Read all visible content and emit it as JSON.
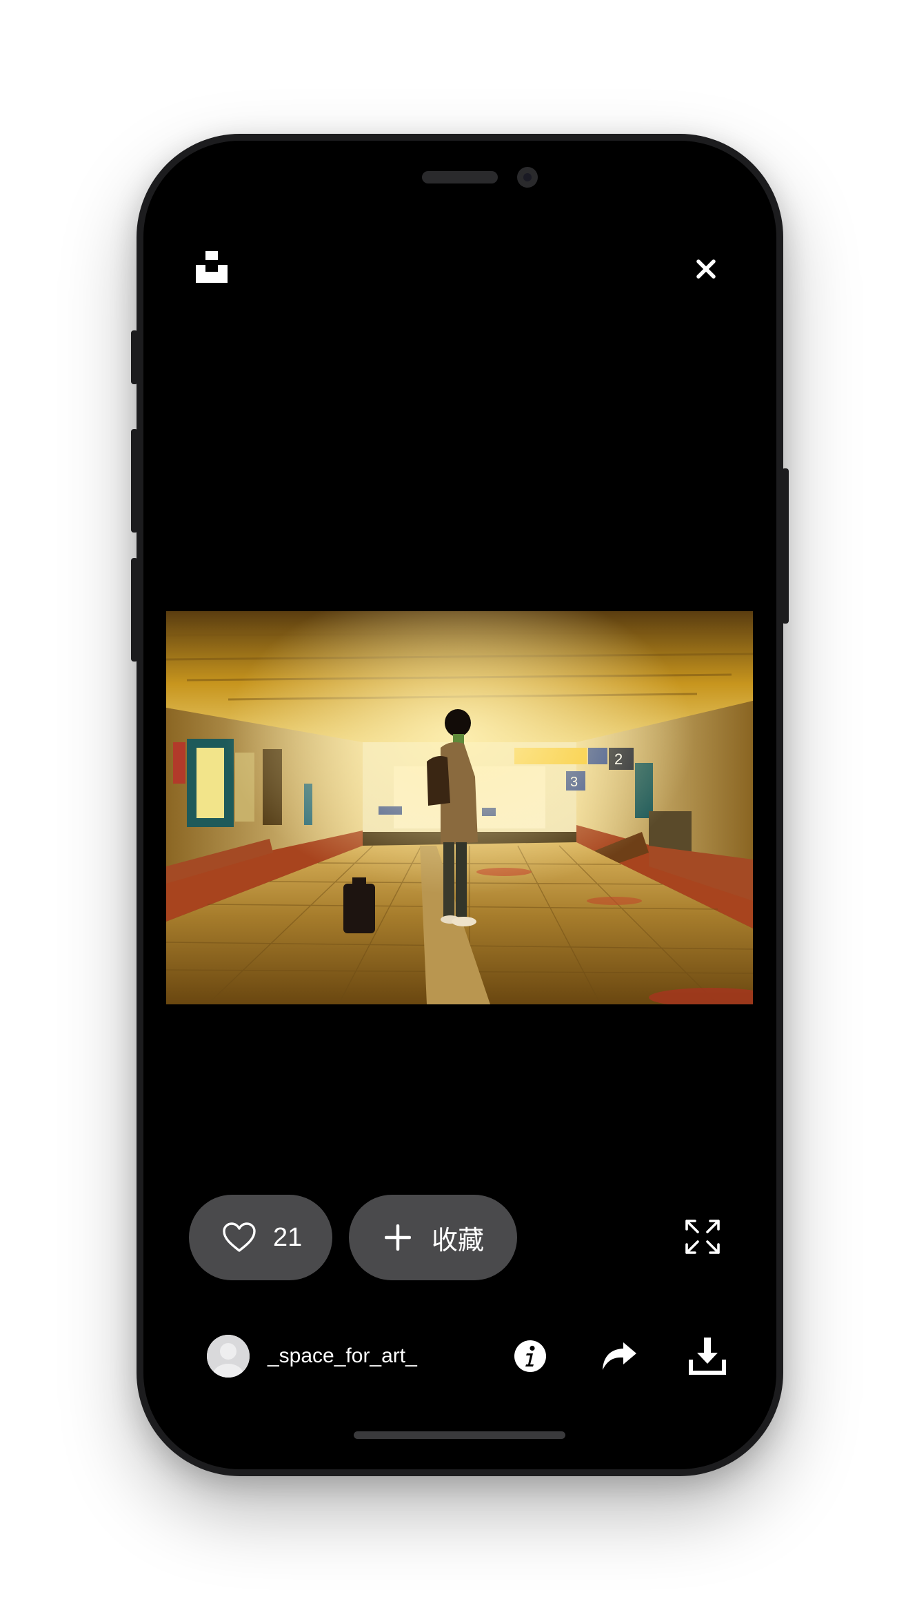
{
  "app": {
    "logo_icon": "unsplash-logo-icon",
    "close_icon": "close-icon"
  },
  "photo": {
    "description_icon": "photo-subway-underpass"
  },
  "actions": {
    "like_icon": "heart-outline-icon",
    "like_count": "21",
    "collect_icon": "plus-icon",
    "collect_label": "收藏",
    "expand_icon": "expand-icon"
  },
  "author": {
    "username": "_space_for_art_",
    "avatar_icon": "avatar-placeholder-icon"
  },
  "toolbar": {
    "info_icon": "info-icon",
    "share_icon": "share-icon",
    "download_icon": "download-icon"
  },
  "colors": {
    "background": "#000000",
    "pill": "#4a4a4c",
    "text": "#ffffff",
    "frame": "#1c1c1e"
  }
}
